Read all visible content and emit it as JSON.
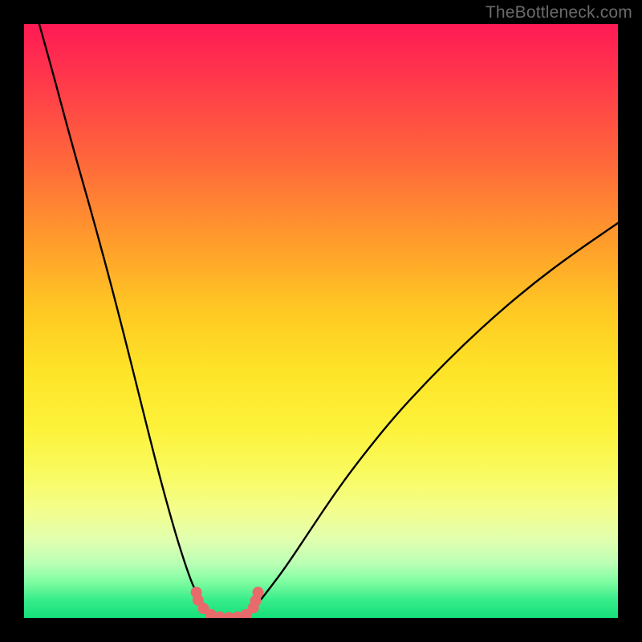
{
  "watermark": {
    "text": "TheBottleneck.com"
  },
  "chart_data": {
    "type": "line",
    "title": "",
    "xlabel": "",
    "ylabel": "",
    "xlim": [
      0,
      100
    ],
    "ylim": [
      0,
      100
    ],
    "series": [
      {
        "name": "left-branch",
        "x": [
          0,
          4,
          8,
          12,
          16,
          20,
          22,
          24,
          26,
          28,
          29,
          30,
          31,
          32
        ],
        "y": [
          109,
          95,
          80,
          66,
          51,
          35,
          27,
          19.5,
          12.5,
          6.5,
          4.3,
          2.5,
          1.2,
          0.4
        ]
      },
      {
        "name": "right-branch",
        "x": [
          37,
          39,
          41,
          44,
          48,
          52,
          56,
          62,
          68,
          74,
          80,
          86,
          92,
          100
        ],
        "y": [
          0.4,
          2.0,
          4.5,
          8.5,
          14.5,
          20.5,
          26,
          33.5,
          40,
          46,
          51.5,
          56.5,
          61,
          66.5
        ]
      },
      {
        "name": "floor",
        "x": [
          32,
          33.5,
          35,
          36,
          37
        ],
        "y": [
          0.4,
          0.1,
          0.0,
          0.1,
          0.4
        ]
      }
    ],
    "markers": {
      "name": "dots",
      "color": "#e86a6a",
      "radius_px": 7,
      "points": [
        {
          "x": 29.0,
          "y": 4.3
        },
        {
          "x": 29.3,
          "y": 3.0
        },
        {
          "x": 30.2,
          "y": 1.6
        },
        {
          "x": 31.5,
          "y": 0.55
        },
        {
          "x": 33.0,
          "y": 0.15
        },
        {
          "x": 34.5,
          "y": 0.05
        },
        {
          "x": 36.0,
          "y": 0.15
        },
        {
          "x": 37.4,
          "y": 0.55
        },
        {
          "x": 38.6,
          "y": 1.7
        },
        {
          "x": 39.0,
          "y": 2.9
        },
        {
          "x": 39.4,
          "y": 4.3
        }
      ]
    },
    "colors": {
      "curve": "#000000",
      "marker": "#e86a6a",
      "frame": "#000000"
    }
  }
}
